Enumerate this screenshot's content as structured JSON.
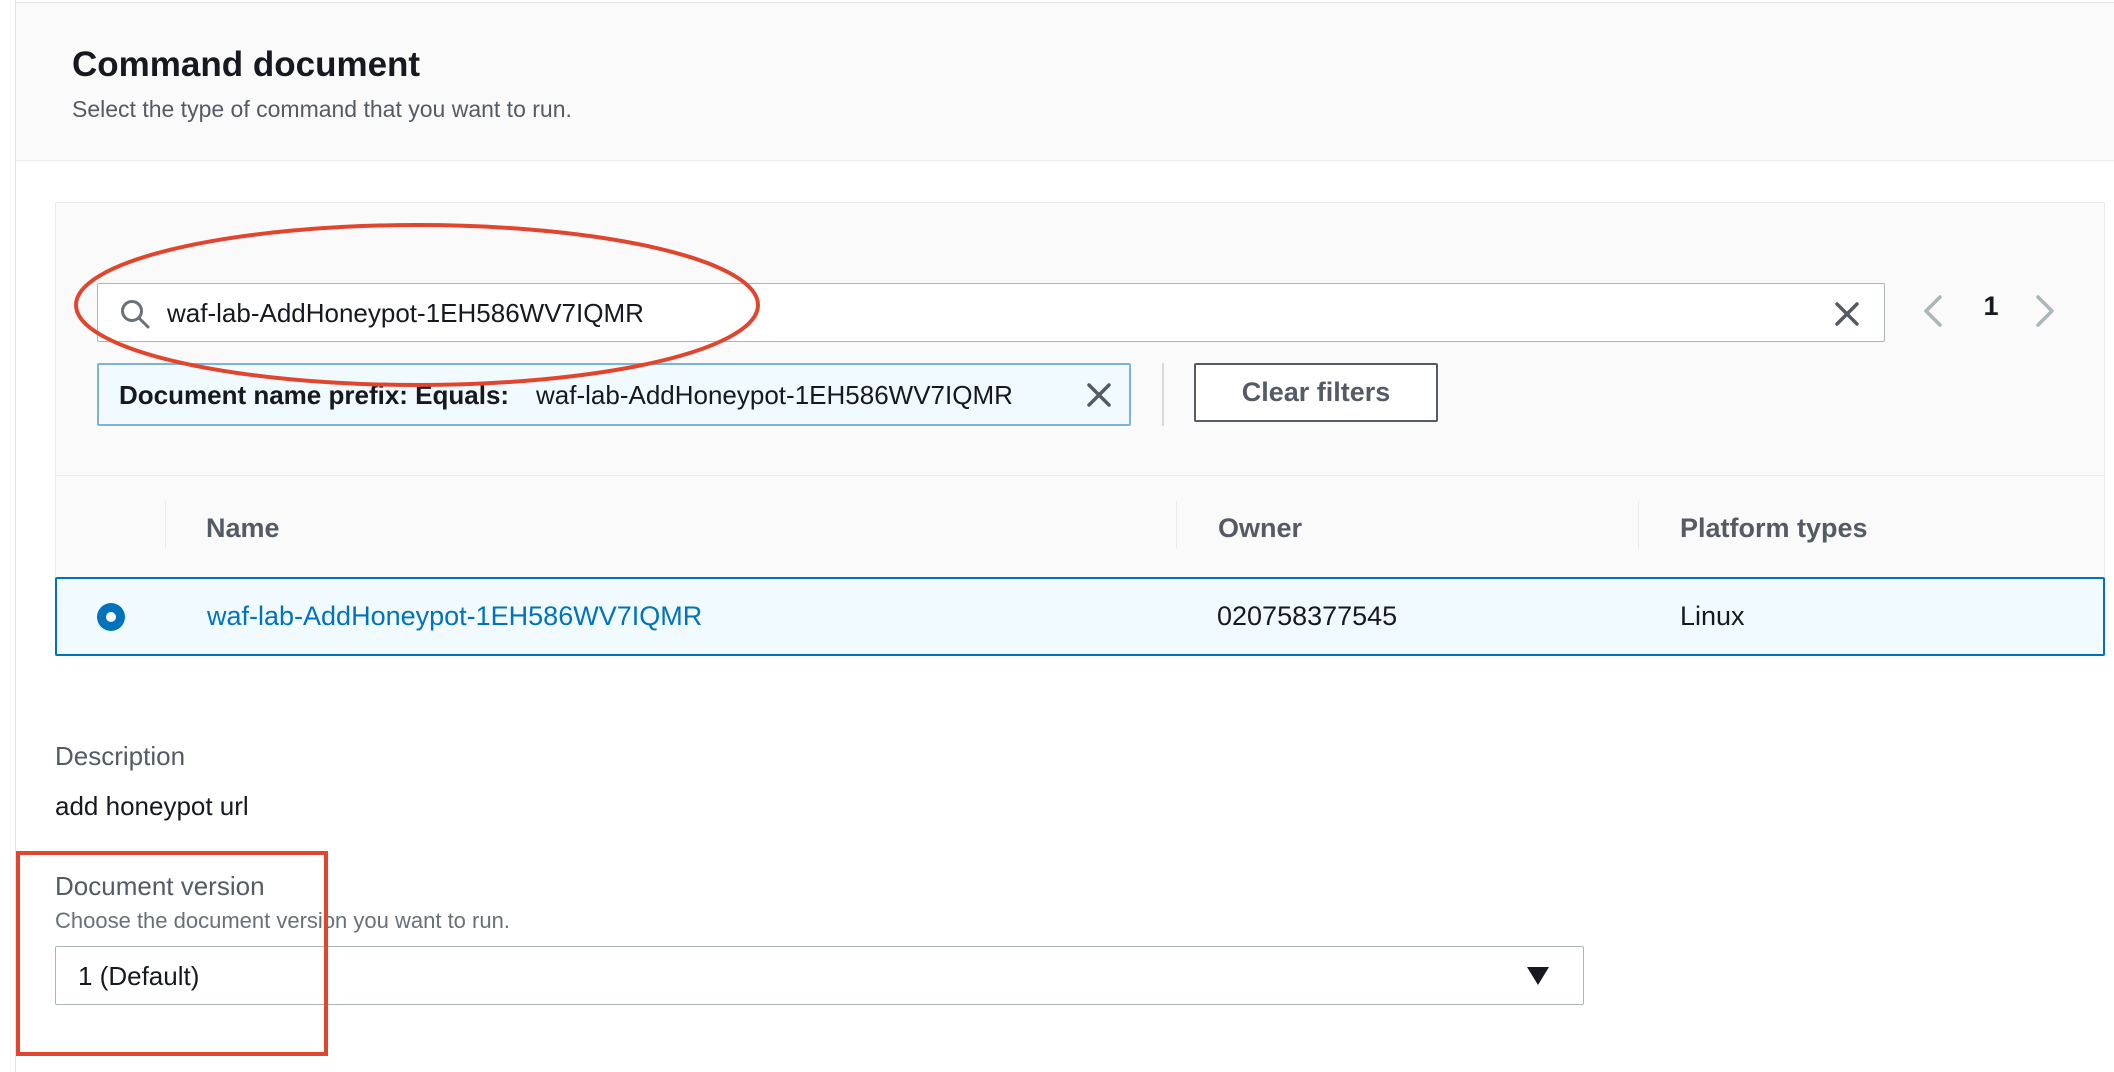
{
  "section": {
    "title": "Command document",
    "subtitle": "Select the type of command that you want to run."
  },
  "search": {
    "value": "waf-lab-AddHoneypot-1EH586WV7IQMR",
    "search_icon": "search-icon",
    "clear_icon": "close-icon"
  },
  "pagination": {
    "current_page": "1",
    "prev_icon": "chevron-left-icon",
    "next_icon": "chevron-right-icon"
  },
  "filter_token": {
    "label": "Document name prefix: Equals:",
    "value": "waf-lab-AddHoneypot-1EH586WV7IQMR",
    "dismiss_icon": "close-icon"
  },
  "clear_filters_label": "Clear filters",
  "table": {
    "columns": [
      "Name",
      "Owner",
      "Platform types"
    ],
    "rows": [
      {
        "selected": true,
        "name": "waf-lab-AddHoneypot-1EH586WV7IQMR",
        "owner": "020758377545",
        "platform": "Linux"
      }
    ]
  },
  "description": {
    "label": "Description",
    "value": "add honeypot url"
  },
  "document_version": {
    "label": "Document version",
    "hint": "Choose the document version you want to run.",
    "selected": "1 (Default)",
    "caret_icon": "caret-down-icon"
  },
  "colors": {
    "accent": "#0073bb",
    "annotation": "#e0452e",
    "token_bg": "#f1faff"
  }
}
